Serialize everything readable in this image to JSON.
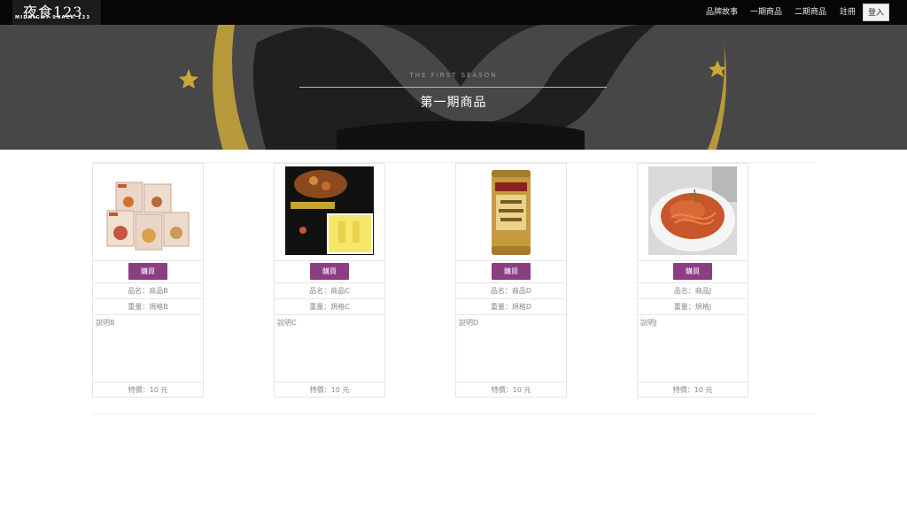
{
  "brand": {
    "name": "夜食123",
    "tagline": "MIDNIGHT SNACK 123"
  },
  "nav": {
    "items": [
      "品牌故事",
      "一期商品",
      "二期商品",
      "註冊"
    ],
    "login_label": "登入"
  },
  "hero": {
    "subtitle": "THE FIRST SEASON",
    "title": "第一期商品"
  },
  "products": [
    {
      "image_icon": "soup-boxes-image",
      "buy_label": "購買",
      "name": "品名：商品B",
      "weight": "重量：規格B",
      "description": "說明B",
      "price": "特價：10 元"
    },
    {
      "image_icon": "curry-package-image",
      "buy_label": "購買",
      "name": "品名：商品C",
      "weight": "重量：規格C",
      "description": "說明C",
      "price": "特價：10 元"
    },
    {
      "image_icon": "cocoa-can-image",
      "buy_label": "購買",
      "name": "品名：商品D",
      "weight": "重量：規格D",
      "description": "說明D",
      "price": "特價：10 元"
    },
    {
      "image_icon": "spaghetti-plate-image",
      "buy_label": "購買",
      "name": "品名：商品J",
      "weight": "重量：規格J",
      "description": "說明J",
      "price": "特價：10 元"
    }
  ],
  "colors": {
    "accent": "#8b3f82",
    "navbar": "#060606",
    "hero_bg": "#474747",
    "moon": "#e8c44a"
  }
}
